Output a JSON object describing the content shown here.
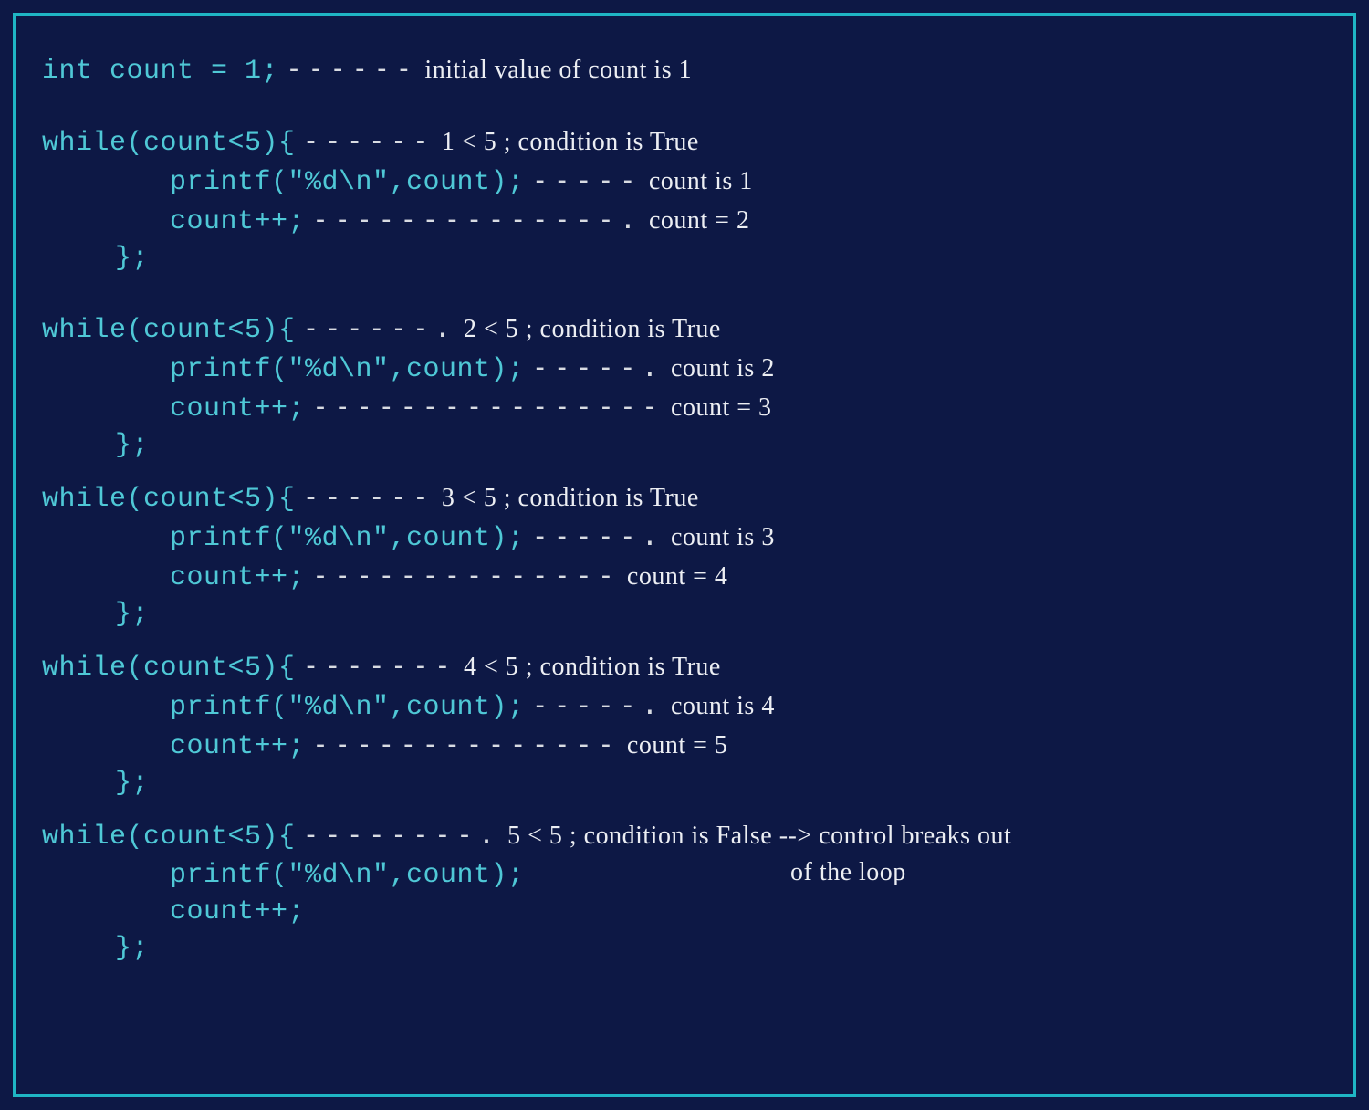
{
  "colors": {
    "bg": "#0d1845",
    "border": "#1fb5c4",
    "code": "#4fc8d6",
    "annot": "#eceef3"
  },
  "init": {
    "code": "int count = 1;",
    "dashes": "------",
    "annot": "initial value of count is 1"
  },
  "blocks": [
    {
      "while": {
        "code": "while(count<5){",
        "dashes": "------",
        "annot": "1 < 5 ; condition is True"
      },
      "printf": {
        "code": "printf(\"%d\\n\",count);",
        "dashes": "-----",
        "annot": "count is 1"
      },
      "inc": {
        "code": "count++;",
        "dashes": "--------------.",
        "annot": "count = 2"
      },
      "close": "};"
    },
    {
      "while": {
        "code": "while(count<5){",
        "dashes": "------.",
        "annot": "2 < 5 ; condition is True"
      },
      "printf": {
        "code": "printf(\"%d\\n\",count);",
        "dashes": "-----.",
        "annot": "count is 2"
      },
      "inc": {
        "code": "count++;",
        "dashes": "----------------",
        "annot": "count = 3"
      },
      "close": "};"
    },
    {
      "while": {
        "code": "while(count<5){",
        "dashes": "------",
        "annot": "3 < 5 ; condition is True"
      },
      "printf": {
        "code": "printf(\"%d\\n\",count);",
        "dashes": "-----.",
        "annot": "count is 3"
      },
      "inc": {
        "code": "count++;",
        "dashes": "--------------",
        "annot": "count = 4"
      },
      "close": "};"
    },
    {
      "while": {
        "code": "while(count<5){",
        "dashes": "-------",
        "annot": "4 < 5 ; condition is True"
      },
      "printf": {
        "code": "printf(\"%d\\n\",count);",
        "dashes": "-----.",
        "annot": "count is 4"
      },
      "inc": {
        "code": "count++;",
        "dashes": "--------------",
        "annot": "count = 5"
      },
      "close": "};"
    },
    {
      "while": {
        "code": "while(count<5){",
        "dashes": "--------.",
        "annot": "5 < 5 ; condition is False --> control breaks out",
        "annot2": "of the loop"
      },
      "printf": {
        "code": "printf(\"%d\\n\",count);",
        "dashes": "",
        "annot": ""
      },
      "inc": {
        "code": "count++;",
        "dashes": "",
        "annot": ""
      },
      "close": "};"
    }
  ]
}
